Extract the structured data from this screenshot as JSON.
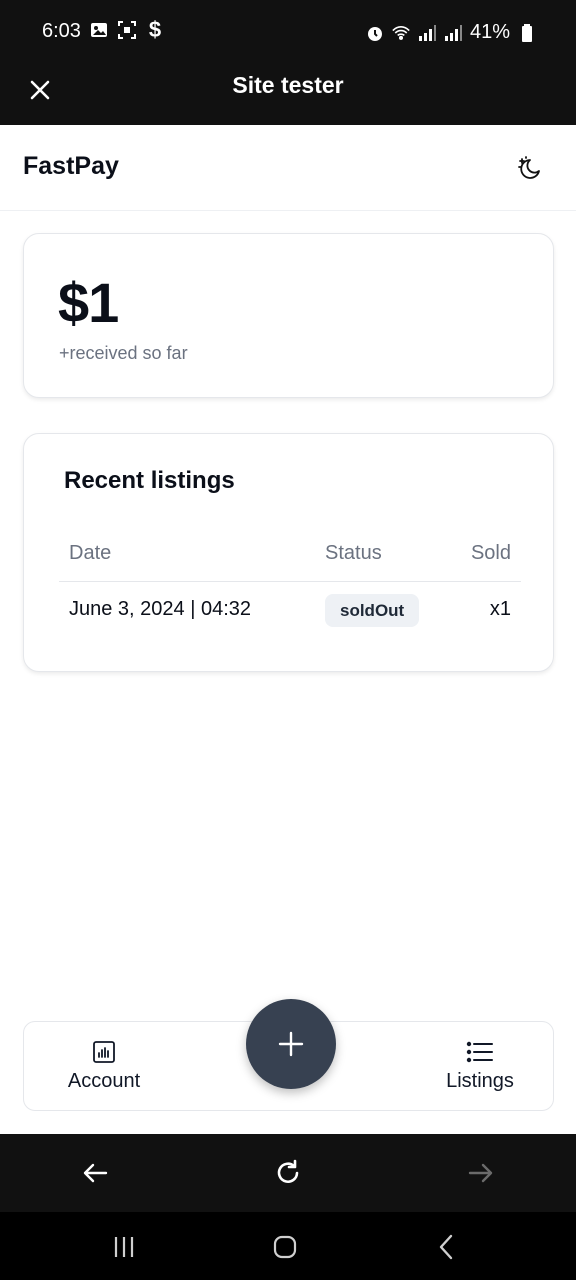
{
  "status_bar": {
    "time": "6:03",
    "battery": "41%",
    "left_icons": [
      "image-icon",
      "screenshot-icon",
      "dollar-icon"
    ],
    "right_icons": [
      "alarm-icon",
      "wifi-icon",
      "signal-icon",
      "signal-icon",
      "battery-icon"
    ]
  },
  "title_bar": {
    "title": "Site tester",
    "close_icon": "close-icon"
  },
  "header": {
    "brand": "FastPay",
    "theme_icon": "moon-stars-icon"
  },
  "balance": {
    "amount": "$1",
    "caption": "+received so far"
  },
  "listings": {
    "title": "Recent listings",
    "columns": [
      "Date",
      "Status",
      "Sold"
    ],
    "rows": [
      {
        "date": "June 3, 2024 | 04:32",
        "status": "soldOut",
        "sold": "x1"
      }
    ]
  },
  "bottom_nav": {
    "account_label": "Account",
    "listings_label": "Listings",
    "add_icon": "plus-icon"
  },
  "browser_controls": {
    "back_icon": "arrow-left-icon",
    "reload_icon": "reload-icon",
    "forward_icon": "arrow-right-icon"
  },
  "colors": {
    "dark_bar": "#111111",
    "fab": "#374151",
    "muted_text": "#6b7280",
    "pill_bg": "#eef1f5"
  }
}
